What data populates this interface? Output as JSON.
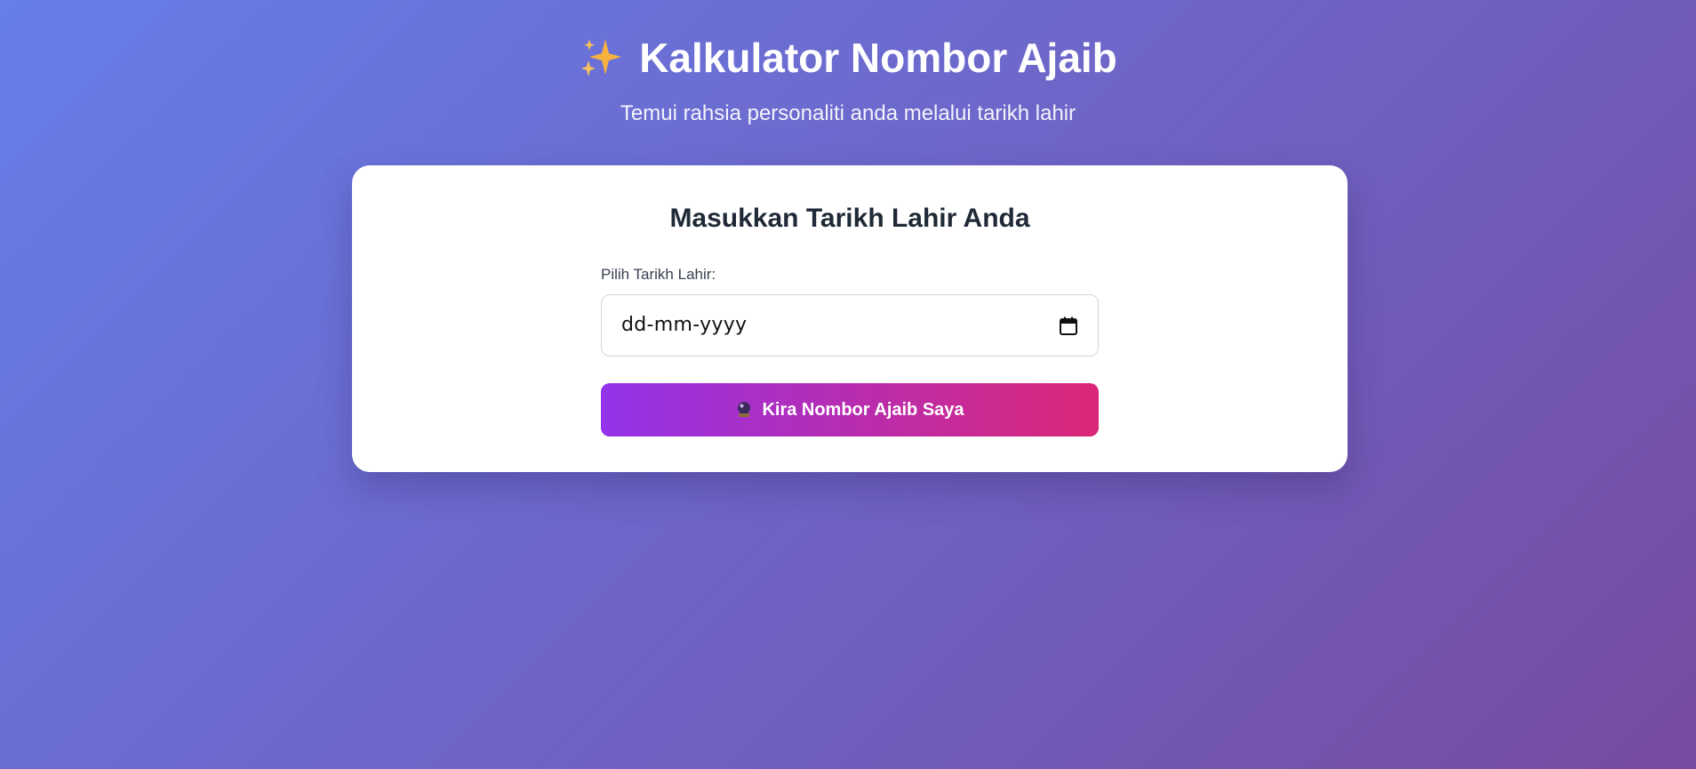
{
  "header": {
    "title": "Kalkulator Nombor Ajaib",
    "title_icon": "sparkles-icon",
    "subtitle": "Temui rahsia personaliti anda melalui tarikh lahir"
  },
  "card": {
    "title": "Masukkan Tarikh Lahir Anda",
    "date_field": {
      "label": "Pilih Tarikh Lahir:",
      "placeholder": "dd-mm-yyyy",
      "value": "",
      "icon": "calendar-icon"
    },
    "submit_button": {
      "label": "Kira Nombor Ajaib Saya",
      "icon": "crystal-ball-icon"
    }
  },
  "colors": {
    "background_start": "#667eea",
    "background_end": "#764ba2",
    "button_start": "#9333ea",
    "button_end": "#db2777",
    "card_title": "#1f2937"
  }
}
